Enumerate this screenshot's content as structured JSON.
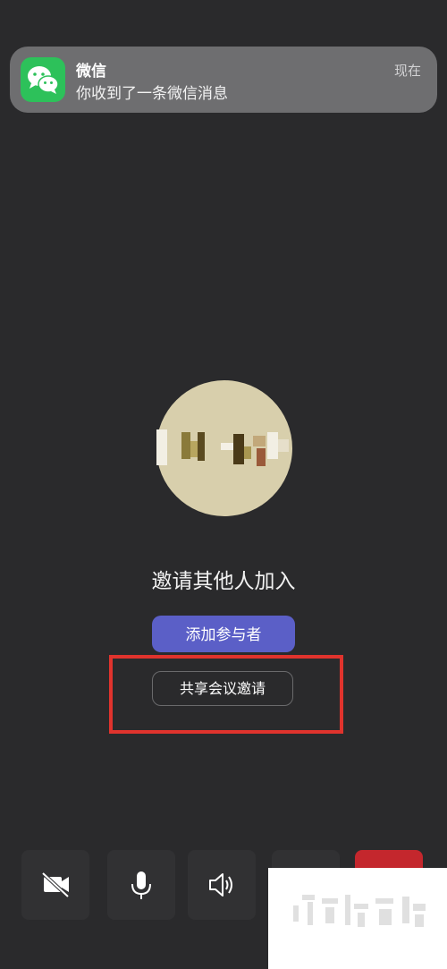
{
  "notification": {
    "app_name": "微信",
    "message": "你收到了一条微信消息",
    "time": "现在",
    "icon": "wechat-icon"
  },
  "meeting": {
    "invite_title": "邀请其他人加入",
    "add_participants_label": "添加参与者",
    "share_invite_label": "共享会议邀请"
  },
  "controls": [
    {
      "name": "camera-off-icon"
    },
    {
      "name": "microphone-icon"
    },
    {
      "name": "speaker-icon"
    },
    {
      "name": "more-icon"
    },
    {
      "name": "hang-up-icon"
    }
  ],
  "colors": {
    "background": "#2a2a2c",
    "accent": "#5b5fc7",
    "hang_up": "#c4272d",
    "highlight": "#e0332d",
    "wechat_green": "#2dc15a"
  }
}
